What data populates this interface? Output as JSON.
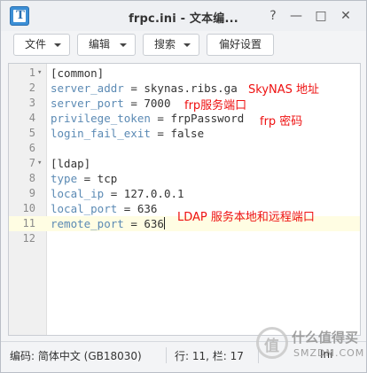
{
  "window": {
    "title": "frpc.ini - 文本编...",
    "app_icon_letter": "T",
    "controls": {
      "help": "?",
      "minimize": "—",
      "maximize": "□",
      "close": "✕"
    }
  },
  "toolbar": {
    "file": "文件",
    "edit": "编辑",
    "search": "搜索",
    "preferences": "偏好设置"
  },
  "editor": {
    "current_line": 11,
    "lines": [
      {
        "num": "1",
        "fold": "▾",
        "key": "",
        "rest": "[common]"
      },
      {
        "num": "2",
        "fold": "",
        "key": "server_addr",
        "rest": " = skynas.ribs.ga"
      },
      {
        "num": "3",
        "fold": "",
        "key": "server_port",
        "rest": " = 7000"
      },
      {
        "num": "4",
        "fold": "",
        "key": "privilege_token",
        "rest": " = frpPassword"
      },
      {
        "num": "5",
        "fold": "",
        "key": "login_fail_exit",
        "rest": " = false"
      },
      {
        "num": "6",
        "fold": "",
        "key": "",
        "rest": ""
      },
      {
        "num": "7",
        "fold": "▾",
        "key": "",
        "rest": "[ldap]"
      },
      {
        "num": "8",
        "fold": "",
        "key": "type",
        "rest": " = tcp"
      },
      {
        "num": "9",
        "fold": "",
        "key": "local_ip",
        "rest": " = 127.0.0.1"
      },
      {
        "num": "10",
        "fold": "",
        "key": "local_port",
        "rest": " = 636"
      },
      {
        "num": "11",
        "fold": "",
        "key": "remote_port",
        "rest": " = 636"
      },
      {
        "num": "12",
        "fold": "",
        "key": "",
        "rest": ""
      }
    ],
    "annotations": {
      "skynas_addr": "SkyNAS 地址",
      "frp_port": "frp服务端口",
      "frp_password": "frp 密码",
      "ldap_ports": "LDAP 服务本地和远程端口"
    }
  },
  "statusbar": {
    "encoding": "编码: 简体中文 (GB18030)",
    "position": "行: 11, 栏: 17",
    "mode": "Ini"
  },
  "watermark": {
    "line1": "什么值得买",
    "line2": "SMZDM.COM"
  },
  "colors": {
    "key": "#5b8ab4",
    "annotation": "#ee1111",
    "current_line_bg": "#fffde3"
  }
}
